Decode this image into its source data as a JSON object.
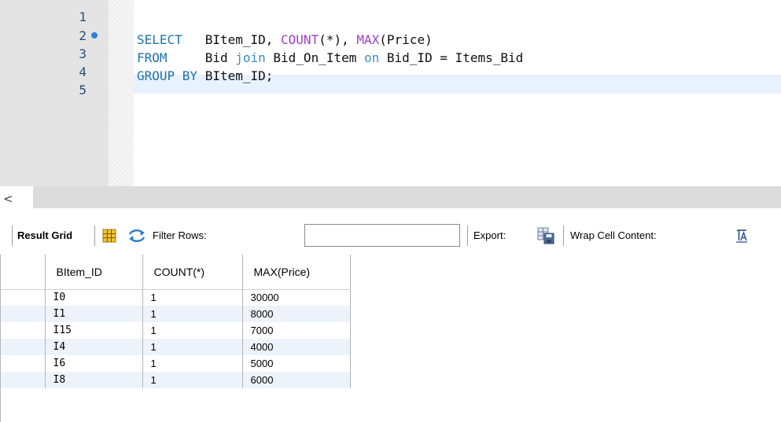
{
  "editor": {
    "line_numbers": [
      "1",
      "2",
      "3",
      "4",
      "5"
    ],
    "lines": [
      [],
      [
        {
          "t": "SELECT",
          "c": "kw"
        },
        {
          "t": "   BItem_ID, ",
          "c": ""
        },
        {
          "t": "COUNT",
          "c": "fn"
        },
        {
          "t": "(*), ",
          "c": ""
        },
        {
          "t": "MAX",
          "c": "fn"
        },
        {
          "t": "(Price)",
          "c": ""
        }
      ],
      [
        {
          "t": "FROM",
          "c": "kw"
        },
        {
          "t": "     Bid ",
          "c": ""
        },
        {
          "t": "join",
          "c": "op"
        },
        {
          "t": " Bid_On_Item ",
          "c": ""
        },
        {
          "t": "on",
          "c": "op"
        },
        {
          "t": " Bid_ID = Items_Bid",
          "c": ""
        }
      ],
      [
        {
          "t": "GROUP BY",
          "c": "kw"
        },
        {
          "t": " BItem_ID;",
          "c": ""
        }
      ],
      []
    ]
  },
  "toolbar": {
    "result_grid_label": "Result Grid",
    "filter_rows_label": "Filter Rows:",
    "filter_value": "",
    "export_label": "Export:",
    "wrap_label": "Wrap Cell Content:"
  },
  "grid": {
    "columns": [
      "BItem_ID",
      "COUNT(*)",
      "MAX(Price)"
    ],
    "rows": [
      [
        "I0",
        "1",
        "30000"
      ],
      [
        "I1",
        "1",
        "8000"
      ],
      [
        "I15",
        "1",
        "7000"
      ],
      [
        "I4",
        "1",
        "4000"
      ],
      [
        "I6",
        "1",
        "5000"
      ],
      [
        "I8",
        "1",
        "6000"
      ]
    ]
  },
  "scrollbar": {
    "left_arrow": "<"
  },
  "colors": {
    "keyword": "#1c73a8",
    "function": "#9c3fc4",
    "operator": "#3d8ccc",
    "line_number": "#2b4f73",
    "current_line": "#e8f2fe",
    "statement_marker": "#2f7fe0"
  },
  "icons": {
    "result_grid": "grid-view-icon",
    "filter": "filter-arrows-icon",
    "export": "export-icon",
    "wrap": "wrap-text-icon"
  }
}
